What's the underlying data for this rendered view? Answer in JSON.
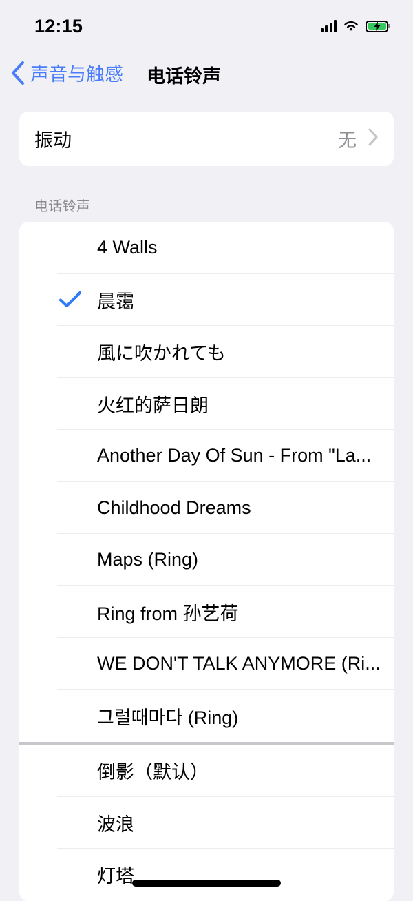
{
  "status_bar": {
    "time": "12:15",
    "signal_icon": "cellular-signal-icon",
    "wifi_icon": "wifi-icon",
    "battery_icon": "battery-charging-icon",
    "battery_color": "#34c759"
  },
  "nav": {
    "back_icon": "chevron-left-icon",
    "back_label": "声音与触感",
    "title": "电话铃声",
    "accent_color": "#4a7dfc"
  },
  "vibration": {
    "title": "振动",
    "value": "无",
    "chevron_icon": "chevron-right-icon"
  },
  "ringtones": {
    "section_header": "电话铃声",
    "check_icon": "checkmark-icon",
    "check_color": "#2f7cf6",
    "custom_items": [
      {
        "label": "4 Walls",
        "selected": false
      },
      {
        "label": "晨霭",
        "selected": true
      },
      {
        "label": "風に吹かれても",
        "selected": false
      },
      {
        "label": "火红的萨日朗",
        "selected": false
      },
      {
        "label": "Another Day Of Sun - From \"La...",
        "selected": false
      },
      {
        "label": "Childhood Dreams",
        "selected": false
      },
      {
        "label": "Maps (Ring)",
        "selected": false
      },
      {
        "label": "Ring from 孙艺荷",
        "selected": false
      },
      {
        "label": "WE DON'T TALK ANYMORE (Ri...",
        "selected": false
      },
      {
        "label": "그럴때마다 (Ring)",
        "selected": false
      }
    ],
    "system_items": [
      {
        "label": "倒影（默认）",
        "selected": false
      },
      {
        "label": "波浪",
        "selected": false
      },
      {
        "label": "灯塔",
        "selected": false
      }
    ]
  },
  "home_indicator": "home-indicator"
}
